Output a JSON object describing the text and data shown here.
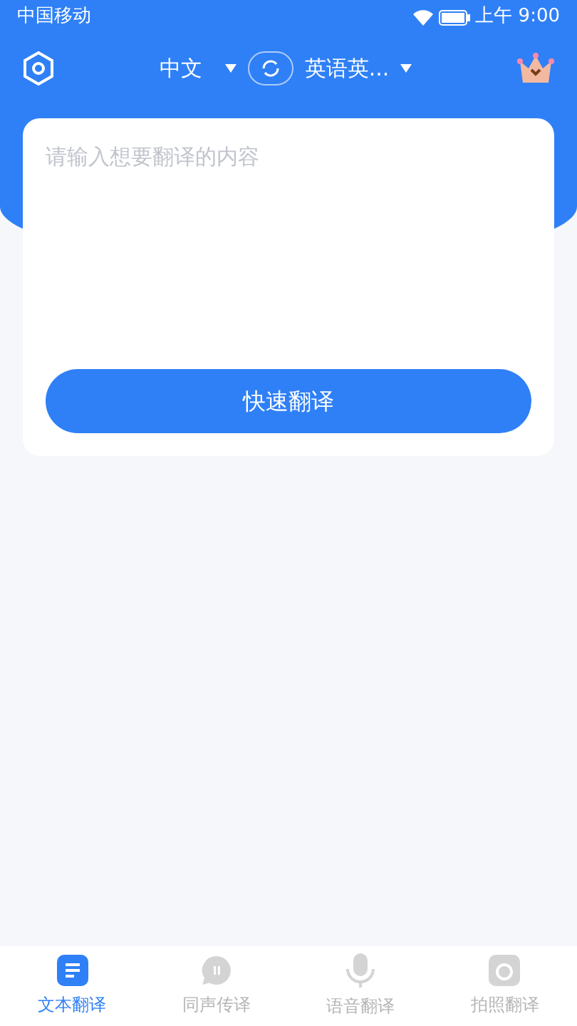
{
  "status_bar": {
    "carrier": "中国移动",
    "time": "上午 9:00"
  },
  "header": {
    "source_language": "中文",
    "target_language": "英语英..."
  },
  "input": {
    "placeholder": "请输入想要翻译的内容"
  },
  "translate_button": "快速翻译",
  "tabs": [
    {
      "label": "文本翻译",
      "kind": "text",
      "selected": true
    },
    {
      "label": "同声传译",
      "kind": "chat",
      "selected": false
    },
    {
      "label": "语音翻译",
      "kind": "mic",
      "selected": false
    },
    {
      "label": "拍照翻译",
      "kind": "camera",
      "selected": false
    }
  ]
}
